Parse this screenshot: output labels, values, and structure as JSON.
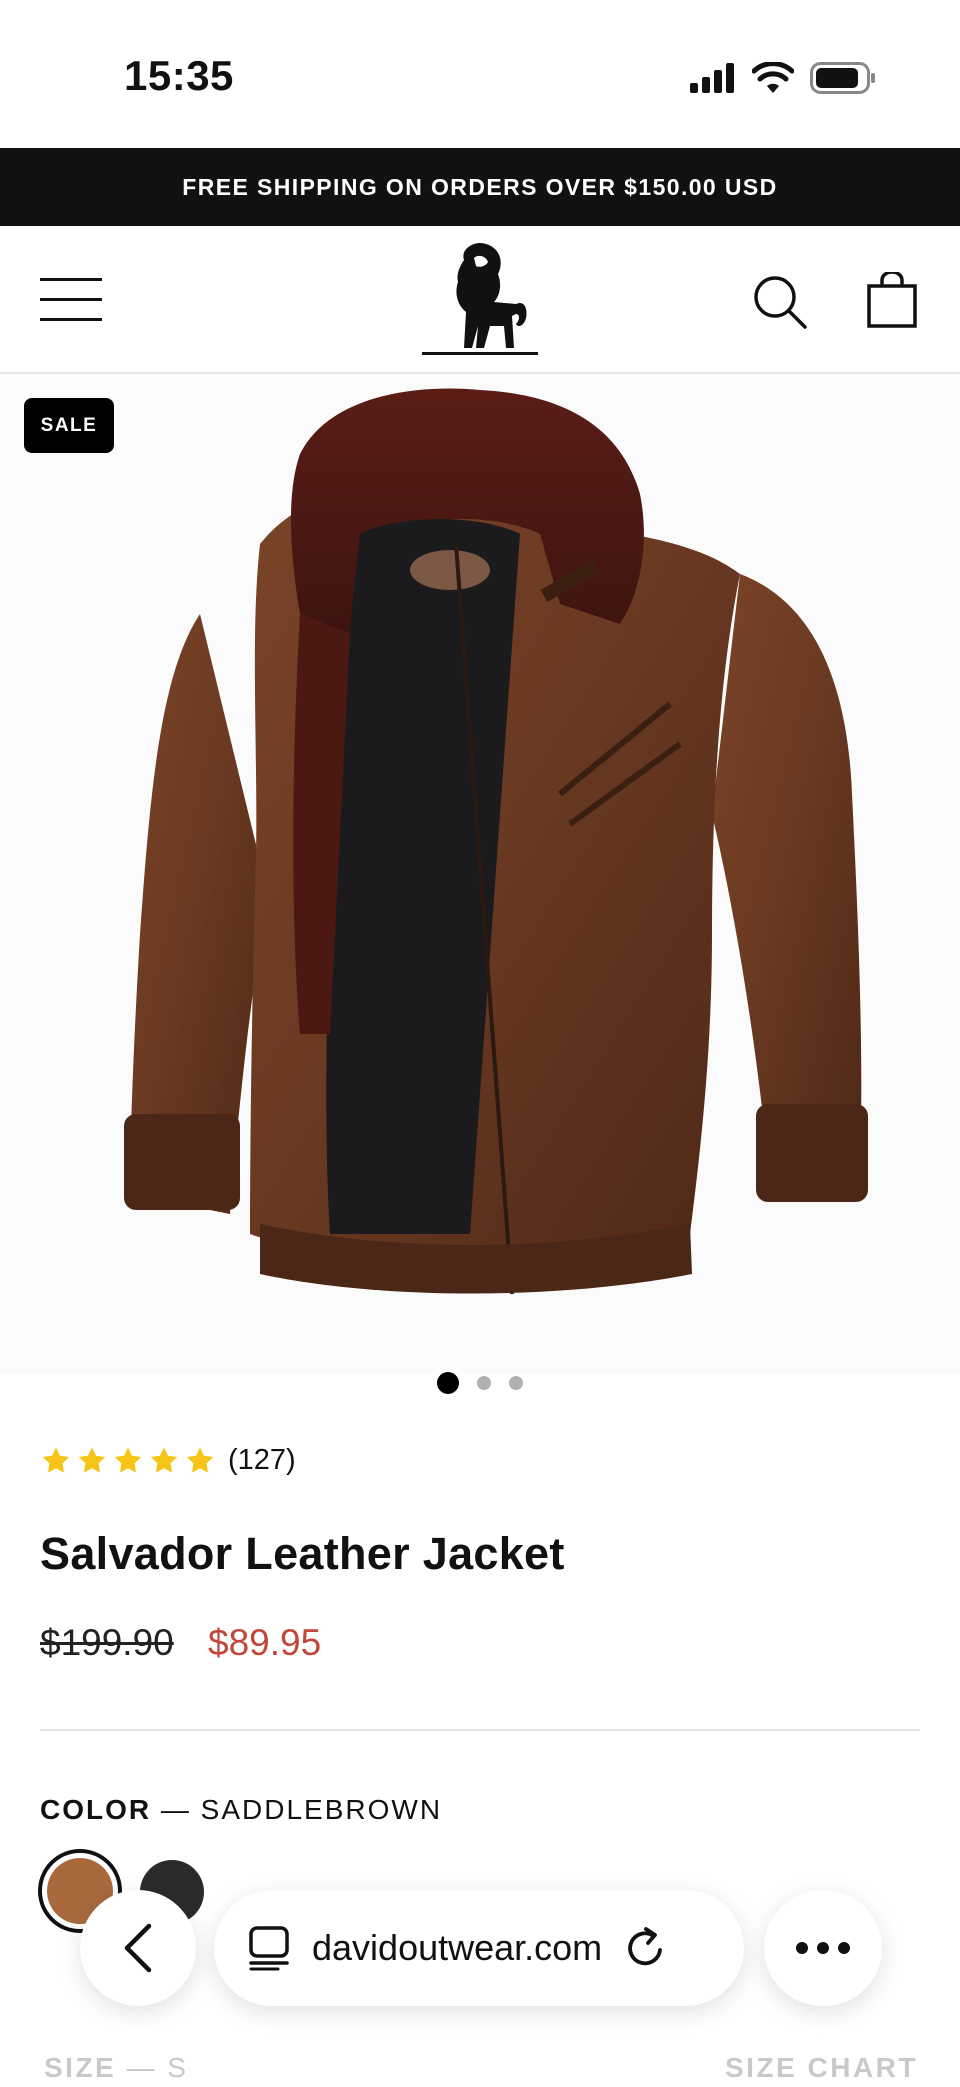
{
  "status_bar": {
    "time": "15:35"
  },
  "announcement": {
    "text": "FREE SHIPPING ON ORDERS OVER $150.00 USD"
  },
  "header": {
    "menu_icon": "hamburger-menu-icon",
    "logo_icon": "lion-logo-icon",
    "search_icon": "search-icon",
    "cart_icon": "shopping-bag-icon"
  },
  "product": {
    "badge": "SALE",
    "gallery": {
      "total": 3,
      "active": 1
    },
    "rating": {
      "stars": 5,
      "count": "(127)"
    },
    "title": "Salvador Leather Jacket",
    "price_original": "$199.90",
    "price_sale": "$89.95",
    "color": {
      "label": "COLOR",
      "separator": " — ",
      "value": "SADDLEBROWN",
      "swatches": [
        {
          "name": "saddlebrown",
          "color": "#a86a3d",
          "selected": true
        },
        {
          "name": "black",
          "color": "#2b2b2b",
          "selected": false
        }
      ]
    },
    "size": {
      "label": "SIZE",
      "separator": " — ",
      "value": "S",
      "chart_label": "SIZE CHART"
    }
  },
  "browser": {
    "url": "davidoutwear.com",
    "back_icon": "chevron-left-icon",
    "tabs_icon": "page-icon",
    "reload_icon": "reload-icon",
    "more_icon": "more-dots-icon"
  },
  "colors": {
    "accent_sale": "#c2473b",
    "announcement_bg": "#111111",
    "star": "#f6c416"
  }
}
